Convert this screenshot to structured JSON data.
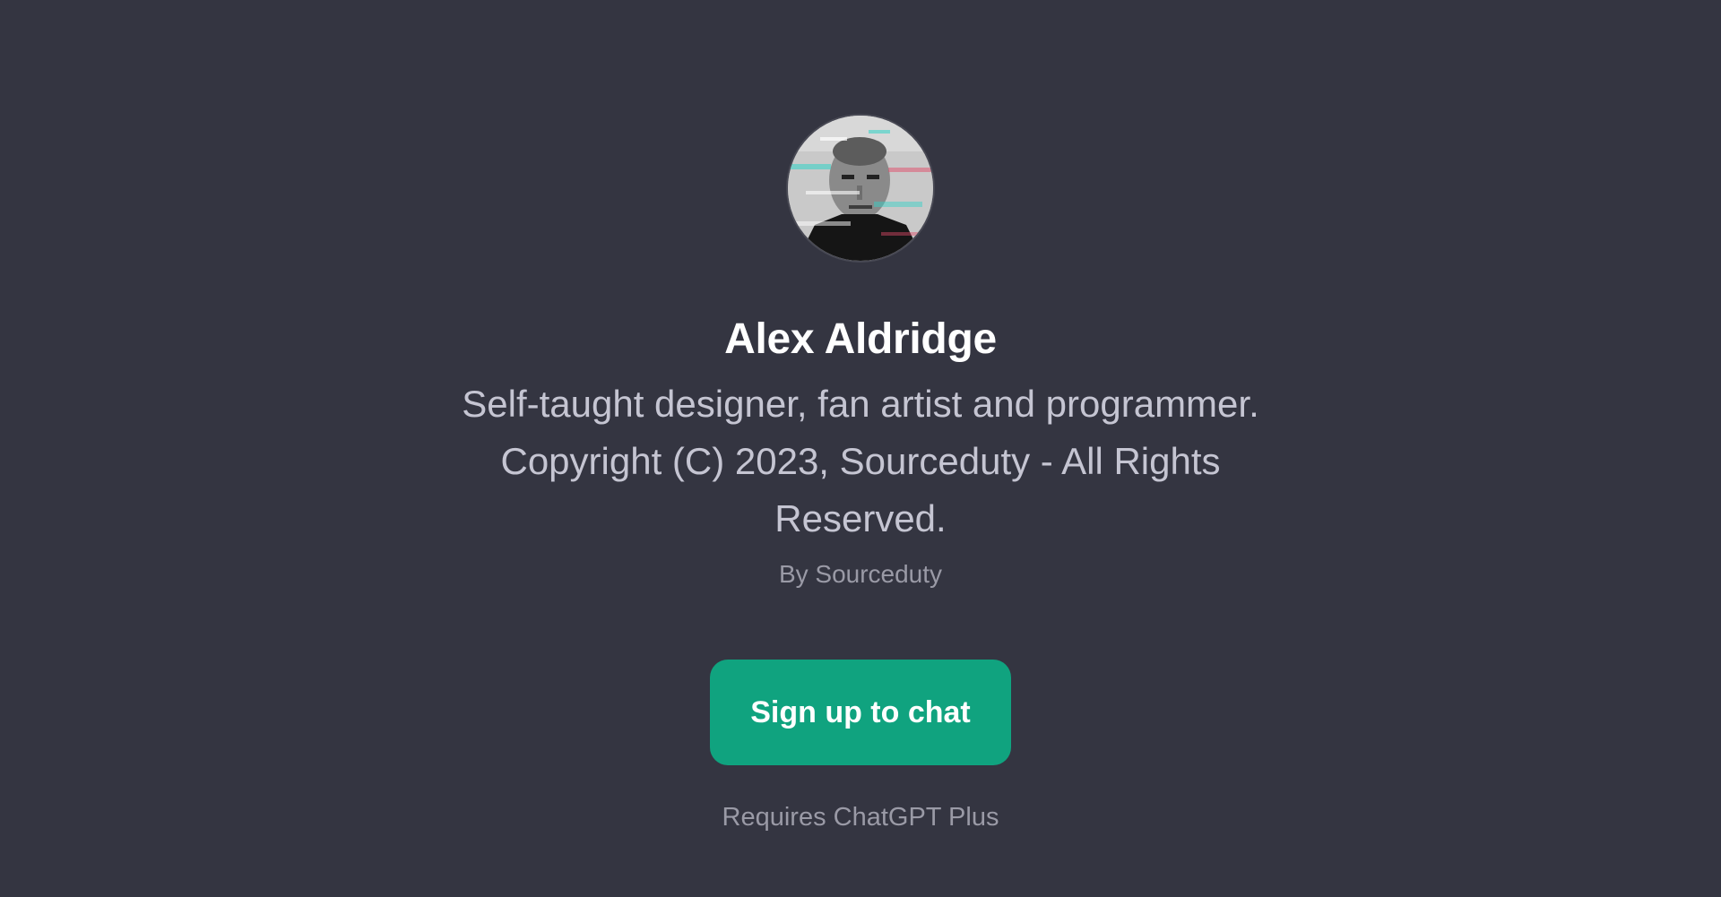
{
  "profile": {
    "name": "Alex Aldridge",
    "description": "Self-taught designer, fan artist and programmer. Copyright (C) 2023, Sourceduty - All Rights Reserved.",
    "author": "By Sourceduty",
    "avatar_icon": "glitch-portrait-avatar"
  },
  "actions": {
    "signup_label": "Sign up to chat",
    "requirement_note": "Requires ChatGPT Plus"
  },
  "colors": {
    "background": "#343541",
    "accent": "#10a37f",
    "title": "#ffffff",
    "description": "#c5c5d2",
    "muted": "#9a9aa6"
  }
}
